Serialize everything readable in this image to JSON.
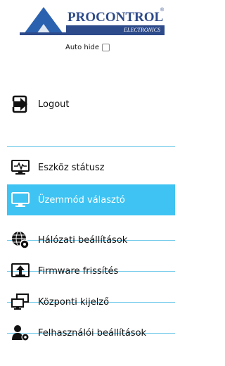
{
  "brand": {
    "name": "PROCONTROL",
    "sub": "ELECTRONICS",
    "registered": "®",
    "colors": {
      "primary": "#2d4a8a",
      "triangle": "#2b62b0"
    }
  },
  "autohide": {
    "label": "Auto hide",
    "checked": false
  },
  "logout": {
    "label": "Logout",
    "icon": "sign-in-icon"
  },
  "menu": {
    "accent": "#3fc3f2",
    "items": [
      {
        "label": "Eszköz státusz",
        "icon": "monitor-pulse-icon",
        "active": false
      },
      {
        "label": "Üzemmód választó",
        "icon": "monitor-icon",
        "active": true
      },
      {
        "label": "Hálózati beállítások",
        "icon": "globe-gear-icon",
        "active": false
      },
      {
        "label": "Firmware frissítés",
        "icon": "upload-icon",
        "active": false
      },
      {
        "label": "Központi kijelző",
        "icon": "dual-monitor-icon",
        "active": false
      },
      {
        "label": "Felhasználói beállítások",
        "icon": "user-gear-icon",
        "active": false
      }
    ]
  }
}
